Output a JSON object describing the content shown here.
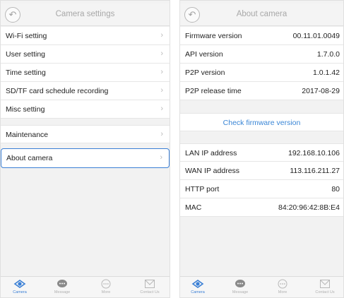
{
  "left_screen": {
    "header": {
      "title": "Camera settings",
      "back_icon": "back-arrow-icon"
    },
    "menu_items": [
      {
        "label": "Wi-Fi setting"
      },
      {
        "label": "User setting"
      },
      {
        "label": "Time setting"
      },
      {
        "label": "SD/TF card schedule recording"
      },
      {
        "label": "Misc setting"
      }
    ],
    "maintenance": {
      "label": "Maintenance"
    },
    "about": {
      "label": "About camera",
      "highlighted": true
    },
    "chevron": "›",
    "highlight_color": "#3a7fd5"
  },
  "right_screen": {
    "header": {
      "title": "About camera",
      "back_icon": "back-arrow-icon"
    },
    "versions": [
      {
        "label": "Firmware version",
        "value": "00.11.01.0049"
      },
      {
        "label": "API version",
        "value": "1.7.0.0"
      },
      {
        "label": "P2P version",
        "value": "1.0.1.42"
      },
      {
        "label": "P2P release time",
        "value": "2017-08-29"
      }
    ],
    "check_firmware": {
      "label": "Check firmware version",
      "color": "#3a86d6"
    },
    "network": [
      {
        "label": "LAN IP address",
        "value": "192.168.10.106"
      },
      {
        "label": "WAN IP address",
        "value": "113.116.211.27"
      },
      {
        "label": "HTTP port",
        "value": "80"
      },
      {
        "label": "MAC",
        "value": "84:20:96:42:8B:E4"
      }
    ]
  },
  "tabbar": {
    "tabs": [
      {
        "label": "Camera",
        "icon": "camera-icon",
        "active": true
      },
      {
        "label": "Message",
        "icon": "message-icon",
        "active": false
      },
      {
        "label": "More",
        "icon": "more-icon",
        "active": false
      },
      {
        "label": "Contact Us",
        "icon": "contact-icon",
        "active": false
      }
    ],
    "active_color": "#3a7fd5",
    "inactive_color": "#b0b0b0"
  }
}
